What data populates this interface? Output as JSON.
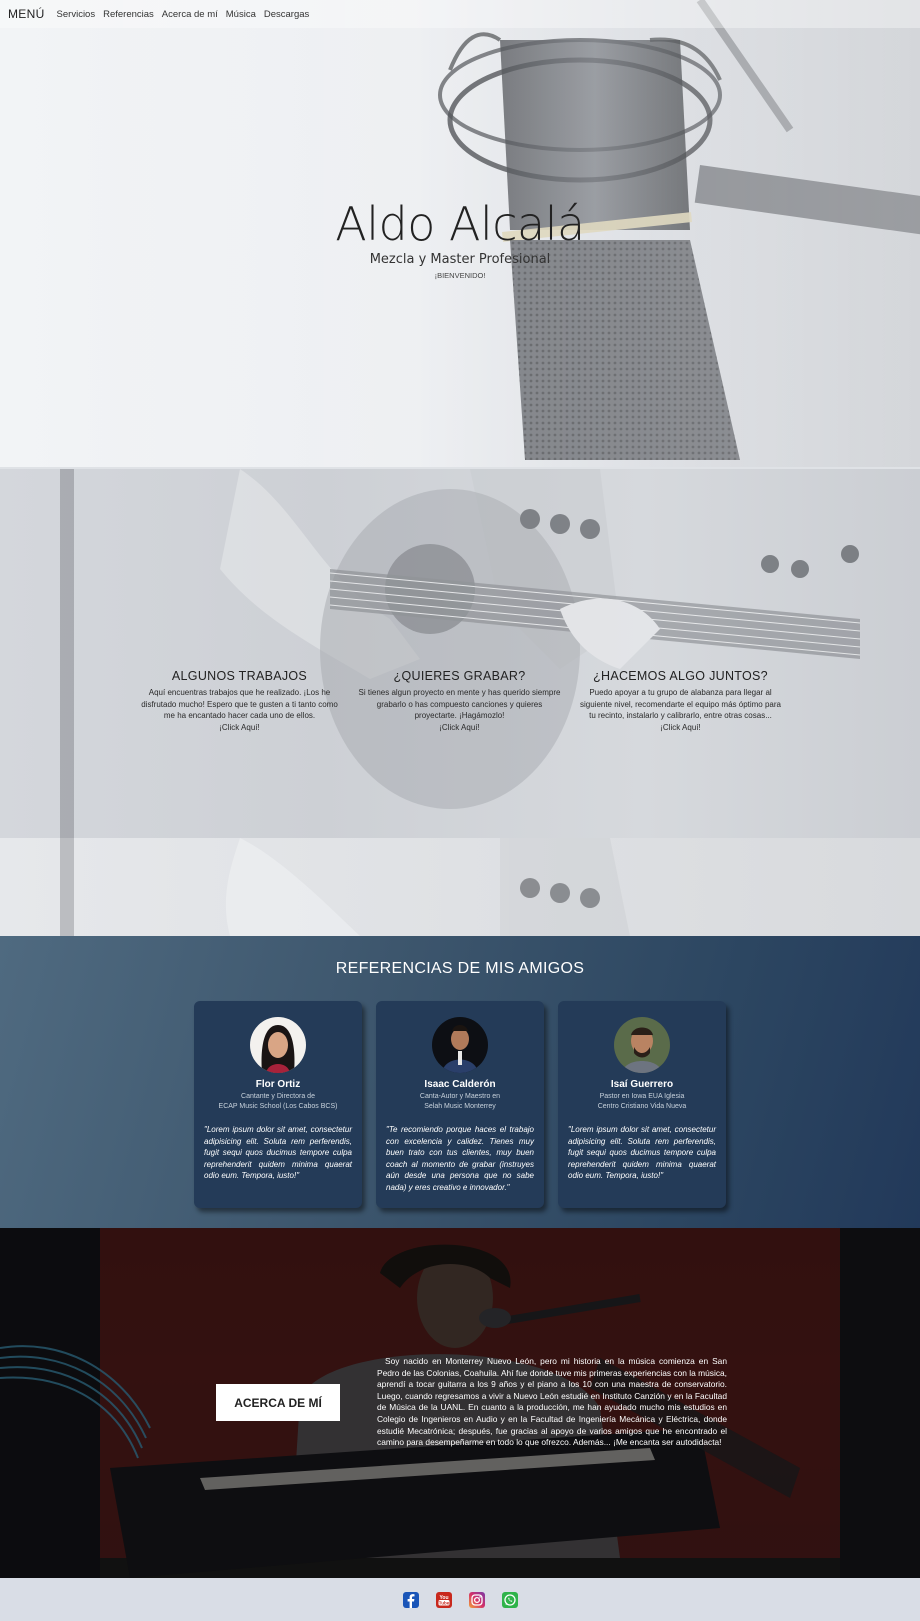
{
  "nav": {
    "brand": "MENÚ",
    "items": [
      "Servicios",
      "Referencias",
      "Acerca de mí",
      "Música",
      "Descargas"
    ]
  },
  "hero": {
    "title": "Aldo Alcalá",
    "subtitle": "Mezcla y Master Profesional",
    "welcome": "¡BIENVENIDO!"
  },
  "services": [
    {
      "title": "ALGUNOS TRABAJOS",
      "text": "Aquí encuentras trabajos que he realizado. ¡Los he disfrutado mucho! Espero que te gusten a ti tanto como me ha encantado hacer cada uno de ellos.",
      "link": "¡Click Aquí!"
    },
    {
      "title": "¿QUIERES GRABAR?",
      "text": "Si tienes algun proyecto en mente y has querido siempre grabarlo o has compuesto canciones y quieres proyectarte. ¡Hagámozlo!",
      "link": "¡Click Aquí!"
    },
    {
      "title": "¿HACEMOS ALGO JUNTOS?",
      "text": "Puedo apoyar a tu grupo de alabanza para llegar al siguiente nivel, recomendarte el equipo más óptimo para tu recinto, instalarlo y calibrarlo, entre otras cosas...",
      "link": "¡Click Aquí!"
    }
  ],
  "references": {
    "heading": "REFERENCIAS DE MIS AMIGOS",
    "cards": [
      {
        "name": "Flor Ortiz",
        "role1": "Cantante y Directora de",
        "role2": "ECAP Music School (Los Cabos BCS)",
        "quote": "\"Lorem ipsum dolor sit amet, consectetur adipisicing elit. Soluta rem perferendis, fugit sequi quos ducimus tempore culpa reprehenderit quidem minima quaerat odio eum. Tempora, iusto!\""
      },
      {
        "name": "Isaac Calderón",
        "role1": "Canta-Autor y Maestro en",
        "role2": "Selah Music Monterrey",
        "quote": "\"Te recomiendo porque haces el trabajo con excelencia y calidez. Tienes muy buen trato con tus clientes, muy buen coach al momento de grabar (instruyes aún desde una persona que no sabe nada) y eres creativo e innovador.\""
      },
      {
        "name": "Isaí Guerrero",
        "role1": "Pastor en Iowa EUA Iglesia",
        "role2": "Centro Cristiano Vida Nueva",
        "quote": "\"Lorem ipsum dolor sit amet, consectetur adipisicing elit. Soluta rem perferendis, fugit sequi quos ducimus tempore culpa reprehenderit quidem minima quaerat odio eum. Tempora, iusto!\""
      }
    ]
  },
  "about": {
    "button": "ACERCA DE MÍ",
    "text": "Soy nacido en Monterrey Nuevo León, pero mi historia en la música comienza en San Pedro de las Colonias, Coahuila. Ahí fue donde tuve mis primeras experiencias con la música, aprendí a tocar guitarra a los 9 años y el piano a los 10 con una maestra de conservatorio. Luego, cuando regresamos a vivir a Nuevo León estudié en Instituto Canzión y en la Facultad de Música de la UANL. En cuanto a la producción, me han ayudado mucho mis estudios en Colegio de Ingenieros en Audio y en la Facultad de Ingeniería Mecánica y Eléctrica, donde estudié Mecatrónica; después, fue gracias al apoyo de varios amigos que he encontrado el camino para desempeñarme en todo lo que ofrezco. Además... ¡Me encanta ser autodidacta!"
  },
  "footer": {
    "icons": [
      "facebook-icon",
      "youtube-icon",
      "instagram-icon",
      "whatsapp-icon"
    ],
    "colors": [
      "#1a55b8",
      "#c8281d",
      "#b22d88",
      "#2fb34a"
    ]
  }
}
